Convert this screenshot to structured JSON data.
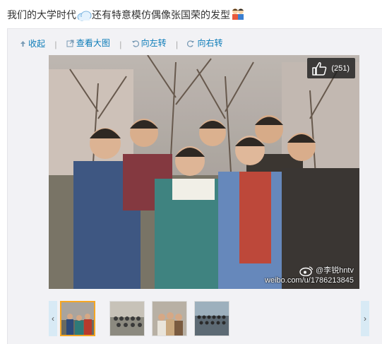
{
  "post": {
    "text": "我们的大学时代",
    "text_after": "还有特意模仿偶像张国荣的发型"
  },
  "toolbar": {
    "collapse": "收起",
    "view_large": "查看大图",
    "rotate_left": "向左转",
    "rotate_right": "向右转",
    "separator": "|"
  },
  "photo": {
    "like_count": "(251)",
    "watermark_user": "@李锐hntv",
    "watermark_url": "weibo.com/u/1786213845"
  },
  "thumbnails": {
    "prev_arrow": "‹",
    "next_arrow": "›"
  },
  "colors": {
    "link": "#0a7bb8",
    "active_thumb_border": "#f5a623",
    "arrow_bg": "#d8eaf5"
  }
}
